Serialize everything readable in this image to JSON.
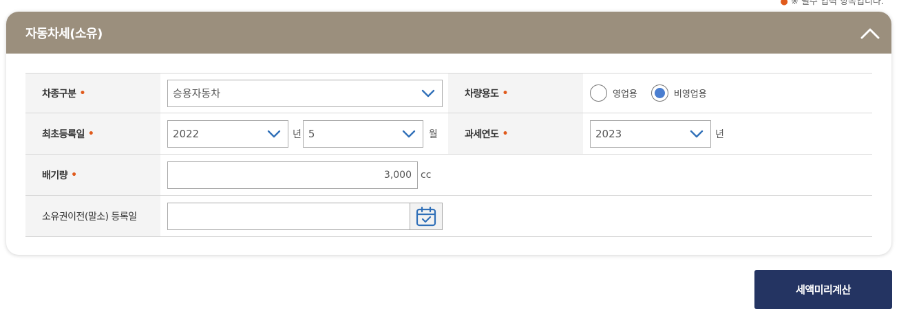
{
  "top_note": {
    "text": "※ 필수 입력 항목입니다.",
    "highlight": "●"
  },
  "panel": {
    "title": "자동차세(소유)",
    "collapse_icon": "chevron-up-icon"
  },
  "form": {
    "required_mark": "•",
    "vehicle_type": {
      "label": "차종구분",
      "selected": "승용자동차"
    },
    "vehicle_use": {
      "label": "차량용도",
      "options": [
        {
          "label": "영업용",
          "checked": false
        },
        {
          "label": "비영업용",
          "checked": true
        }
      ]
    },
    "first_registration": {
      "label": "최초등록일",
      "year": "2022",
      "year_unit": "년",
      "month": "5",
      "month_unit": "월"
    },
    "tax_year": {
      "label": "과세연도",
      "year": "2023",
      "unit": "년"
    },
    "displacement": {
      "label": "배기량",
      "value": "3,000",
      "unit": "cc"
    },
    "transfer_date": {
      "label": "소유권이전(말소) 등록일",
      "value": "",
      "icon": "calendar-icon"
    }
  },
  "actions": {
    "calculate_label": "세액미리계산"
  },
  "colors": {
    "header": "#9b8f7d",
    "required": "#e05a1c",
    "radio_selected": "#4a7ed0",
    "button": "#243462"
  }
}
